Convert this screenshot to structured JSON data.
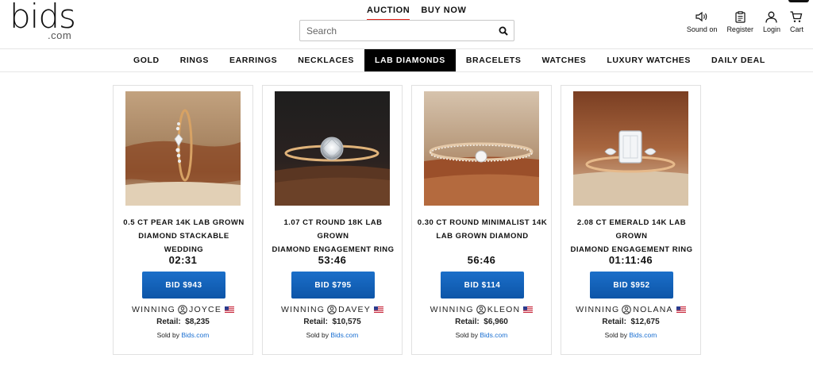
{
  "brand": {
    "logo_main": "bids",
    "logo_sub": ".com"
  },
  "modes": [
    {
      "label": "AUCTION",
      "active": true
    },
    {
      "label": "BUY NOW",
      "active": false
    }
  ],
  "search": {
    "placeholder": "Search",
    "value": ""
  },
  "utilities": [
    {
      "label": "Sound on",
      "icon": "speaker-icon"
    },
    {
      "label": "Register",
      "icon": "clipboard-icon"
    },
    {
      "label": "Login",
      "icon": "user-icon"
    },
    {
      "label": "Cart",
      "icon": "cart-icon"
    }
  ],
  "nav": {
    "items": [
      "GOLD",
      "RINGS",
      "EARRINGS",
      "NECKLACES",
      "LAB DIAMONDS",
      "BRACELETS",
      "WATCHES",
      "LUXURY WATCHES",
      "DAILY DEAL"
    ],
    "active": "LAB DIAMONDS"
  },
  "products": [
    {
      "title_line1": "0.5 CT PEAR 14K LAB GROWN",
      "title_line2": "DIAMOND STACKABLE WEDDING",
      "timer": "02:31",
      "bid": "BID $943",
      "winning_label": "WINNING",
      "winner": "JOYCE",
      "retail_label": "Retail:",
      "retail": "$8,235",
      "sold_by_label": "Sold by",
      "seller": "Bids.com"
    },
    {
      "title_line1": "1.07 CT ROUND 18K LAB GROWN",
      "title_line2": "DIAMOND ENGAGEMENT RING",
      "timer": "53:46",
      "bid": "BID $795",
      "winning_label": "WINNING",
      "winner": "DAVEY",
      "retail_label": "Retail:",
      "retail": "$10,575",
      "sold_by_label": "Sold by",
      "seller": "Bids.com"
    },
    {
      "title_line1": "0.30 CT ROUND MINIMALIST 14K",
      "title_line2": "LAB GROWN DIAMOND",
      "timer": "56:46",
      "bid": "BID $114",
      "winning_label": "WINNING",
      "winner": "KLEON",
      "retail_label": "Retail:",
      "retail": "$6,960",
      "sold_by_label": "Sold by",
      "seller": "Bids.com"
    },
    {
      "title_line1": "2.08 CT EMERALD 14K LAB GROWN",
      "title_line2": "DIAMOND ENGAGEMENT RING",
      "timer": "01:11:46",
      "bid": "BID $952",
      "winning_label": "WINNING",
      "winner": "NOLANA",
      "retail_label": "Retail:",
      "retail": "$12,675",
      "sold_by_label": "Sold by",
      "seller": "Bids.com"
    }
  ],
  "colors": {
    "accent_red": "#e2231a",
    "bid_blue": "#0d55a8",
    "link_blue": "#1a6fd1",
    "nav_active_bg": "#000000"
  }
}
